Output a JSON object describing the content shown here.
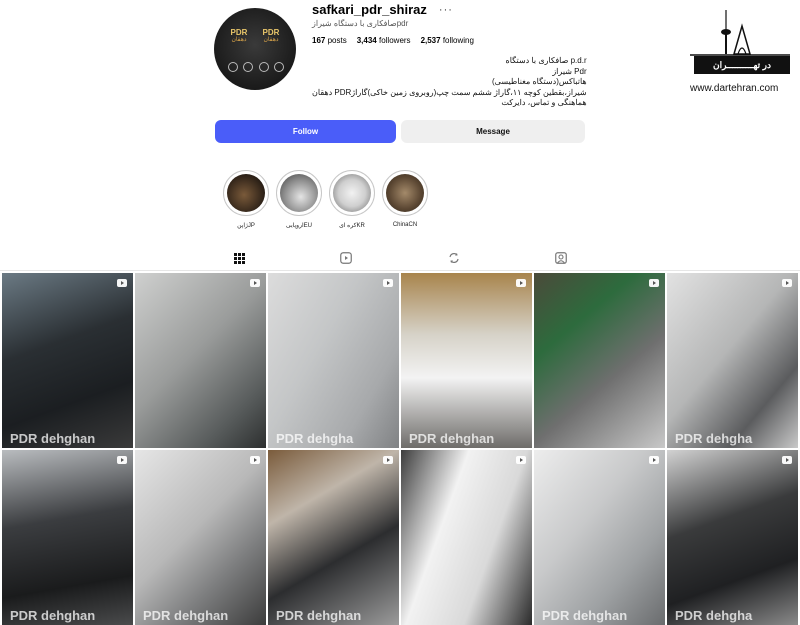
{
  "profile": {
    "username": "safkari_pdr_shiraz",
    "more": "···",
    "subname": "pdrصافکاری با دستگاه شیراز",
    "stats": {
      "posts": "167",
      "posts_label": "posts",
      "followers": "3,434",
      "followers_label": "followers",
      "following": "2,537",
      "following_label": "following"
    },
    "bio": [
      "p.d.r صافکاری با دستگاه",
      "Pdr شیراز",
      "هاتباکس(دستگاه مغناطیسی)",
      "شیراز،بقطین کوچه ۱۱،گاراژ ششم سمت چپ(روبروی زمین خاکی)گاراژPDR دهقان",
      "هماهنگی و تماس، دایرکت"
    ],
    "avatar_text": {
      "left": "PDR",
      "left_sub": "دهقان",
      "right": "PDR",
      "right_sub": "دهقان"
    }
  },
  "buttons": {
    "follow": "Follow",
    "message": "Message"
  },
  "highlights": [
    {
      "label": "ژاپنJP",
      "color": "#3b2a1e"
    },
    {
      "label": "اروپاییEU",
      "color": "#7c7c7c"
    },
    {
      "label": "کره ایKR",
      "color": "#d8d8d8"
    },
    {
      "label": "ChinaCN",
      "color": "#5a4632"
    }
  ],
  "tabs": [
    {
      "name": "posts",
      "icon": "grid-icon",
      "active": true
    },
    {
      "name": "reels",
      "icon": "reels-icon",
      "active": false
    },
    {
      "name": "reposts",
      "icon": "repost-icon",
      "active": false
    },
    {
      "name": "tagged",
      "icon": "tagged-icon",
      "active": false
    }
  ],
  "brand": {
    "flag_text": "در تهــــــــــران",
    "url": "www.dartehran.com"
  },
  "posts": [
    {
      "bg": "linear-gradient(160deg,#6b7a84 0%,#2a2f33 40%,#1b1e21 70%,#3a3a3a 100%)",
      "watermark": "PDR dehghan"
    },
    {
      "bg": "linear-gradient(135deg,#cfd0cf 0%,#9a9c9b 45%,#565a5a 80%,#2d2f2f 100%)",
      "watermark": ""
    },
    {
      "bg": "linear-gradient(120deg,#dcdcdc 0%,#c4c6c7 40%,#a7a9ab 75%,#808284 100%)",
      "watermark": "PDR dehgha"
    },
    {
      "bg": "linear-gradient(180deg,#a8844c 0%,#d6d2c8 35%,#f3f3f3 60%,#6e6c69 100%)",
      "watermark": "PDR dehghan"
    },
    {
      "bg": "linear-gradient(140deg,#4b4a3a 0%,#2d6b3d 30%,#6f6f6f 60%,#c8c8c8 100%)",
      "watermark": ""
    },
    {
      "bg": "linear-gradient(130deg,#e2e2e2 0%,#b5b6b6 45%,#5b5c5e 75%,#c9c9c9 100%)",
      "watermark": "PDR dehgha"
    },
    {
      "bg": "linear-gradient(170deg,#b9bcbf 0%,#3b3d40 40%,#1a1b1c 75%,#4a4b4c 100%)",
      "watermark": "PDR dehghan"
    },
    {
      "bg": "linear-gradient(135deg,#e6e6e6 0%,#b8b8b8 45%,#7d7e7f 70%,#3c3c3c 100%)",
      "watermark": "PDR dehghan"
    },
    {
      "bg": "linear-gradient(150deg,#7a5b3b 0%,#bfb5a9 30%,#2c2d2f 60%,#9b9b9b 100%)",
      "watermark": "PDR dehghan"
    },
    {
      "bg": "linear-gradient(110deg,#3d3d3d 0%,#f2f2f2 35%,#d9d9d9 65%,#2b2b2b 100%)",
      "watermark": ""
    },
    {
      "bg": "linear-gradient(130deg,#ededed 0%,#c8c9ca 40%,#9ea1a3 70%,#6a6c6e 100%)",
      "watermark": "PDR dehghan"
    },
    {
      "bg": "linear-gradient(160deg,#d2d2d2 0%,#3a3b3c 40%,#1f2022 70%,#8a8a8a 100%)",
      "watermark": "PDR dehgha"
    }
  ]
}
